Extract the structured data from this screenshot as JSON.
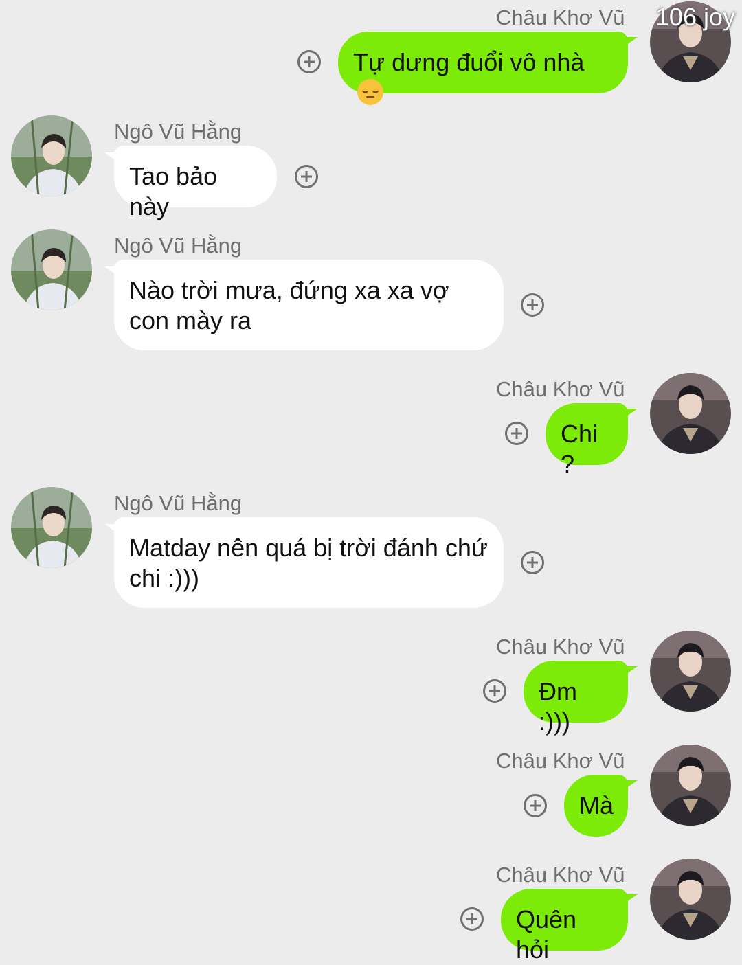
{
  "watermark": "106 joy",
  "messages": [
    {
      "sender": "Châu Khơ Vũ",
      "direction": "out",
      "text": "Tự dưng đuổi vô nhà",
      "emoji": "relieved-face-icon"
    },
    {
      "sender": "Ngô Vũ Hằng",
      "direction": "in",
      "text": "Tao bảo này"
    },
    {
      "sender": "Ngô Vũ Hằng",
      "direction": "in",
      "text": "Nào trời mưa, đứng xa xa vợ con mày ra"
    },
    {
      "sender": "Châu Khơ Vũ",
      "direction": "out",
      "text": "Chi ?"
    },
    {
      "sender": "Ngô Vũ Hằng",
      "direction": "in",
      "text": "Matday nên quá bị trời đánh chứ chi :)))"
    },
    {
      "sender": "Châu Khơ Vũ",
      "direction": "out",
      "text": "Đm :)))"
    },
    {
      "sender": "Châu Khơ Vũ",
      "direction": "out",
      "text": "Mà"
    },
    {
      "sender": "Châu Khơ Vũ",
      "direction": "out",
      "text": "Quên hỏi"
    }
  ],
  "colors": {
    "outgoing_bubble": "#7ceb07",
    "incoming_bubble": "#ffffff",
    "background": "#ececec"
  }
}
